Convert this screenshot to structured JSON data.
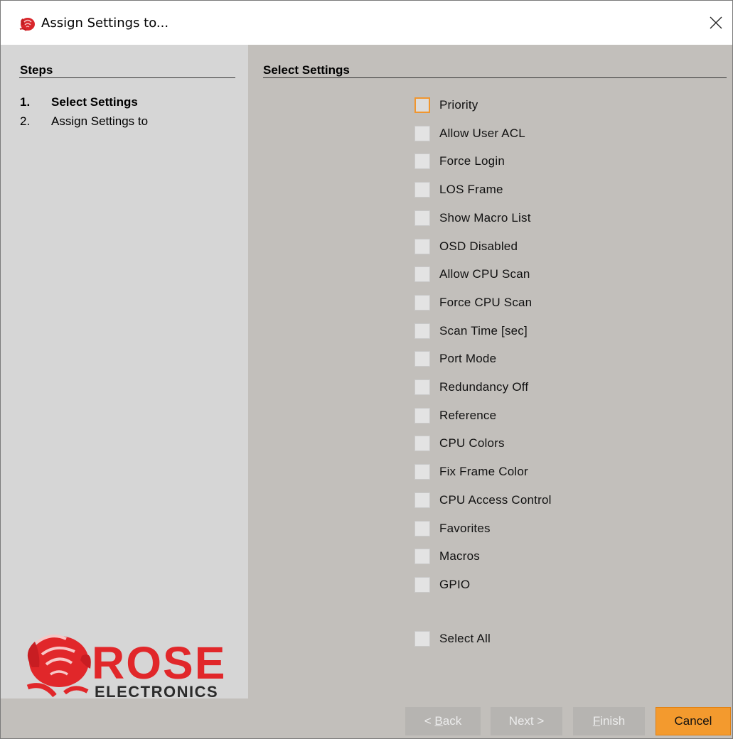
{
  "window": {
    "title": "Assign Settings to...",
    "accent_color": "#f39a2e"
  },
  "steps": {
    "heading": "Steps",
    "items": [
      {
        "num": "1.",
        "label": "Select Settings",
        "active": true
      },
      {
        "num": "2.",
        "label": "Assign Settings to",
        "active": false
      }
    ]
  },
  "logo": {
    "brand": "ROSE",
    "subtitle": "ELECTRONICS",
    "color": "#e1272a"
  },
  "settings": {
    "heading": "Select Settings",
    "options": [
      {
        "label": "Priority",
        "checked": false,
        "focused": true
      },
      {
        "label": "Allow User ACL",
        "checked": false
      },
      {
        "label": "Force Login",
        "checked": false
      },
      {
        "label": "LOS Frame",
        "checked": false
      },
      {
        "label": "Show Macro List",
        "checked": false
      },
      {
        "label": "OSD Disabled",
        "checked": false
      },
      {
        "label": "Allow CPU Scan",
        "checked": false
      },
      {
        "label": "Force CPU Scan",
        "checked": false
      },
      {
        "label": "Scan Time [sec]",
        "checked": false
      },
      {
        "label": "Port Mode",
        "checked": false
      },
      {
        "label": "Redundancy Off",
        "checked": false
      },
      {
        "label": "Reference",
        "checked": false
      },
      {
        "label": "CPU Colors",
        "checked": false
      },
      {
        "label": "Fix Frame Color",
        "checked": false
      },
      {
        "label": "CPU Access Control",
        "checked": false
      },
      {
        "label": "Favorites",
        "checked": false
      },
      {
        "label": "Macros",
        "checked": false
      },
      {
        "label": "GPIO",
        "checked": false
      }
    ],
    "select_all": {
      "label": "Select All",
      "checked": false
    }
  },
  "buttons": {
    "back": {
      "prefix": "< ",
      "mnemonic": "B",
      "rest": "ack",
      "enabled": false
    },
    "next": {
      "label": "Next >",
      "enabled": false
    },
    "finish": {
      "mnemonic": "F",
      "rest": "inish",
      "enabled": false
    },
    "cancel": {
      "label": "Cancel",
      "enabled": true
    }
  }
}
